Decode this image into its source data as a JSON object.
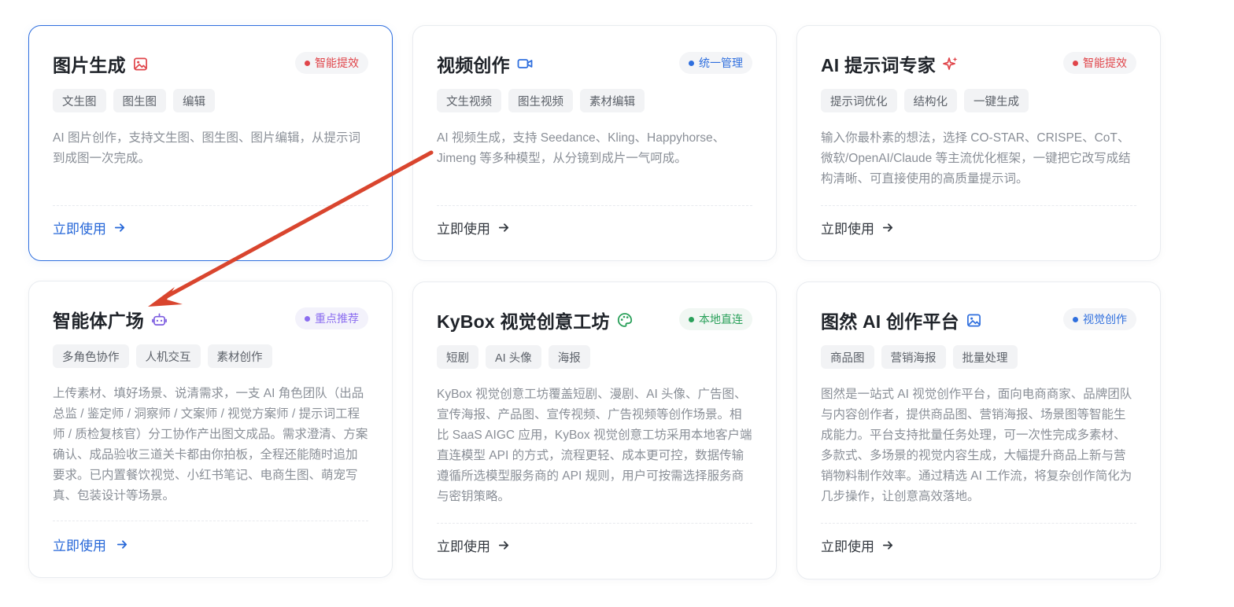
{
  "cards": [
    {
      "title": "图片生成",
      "title_icon": "image-icon",
      "title_icon_color": "#e0454a",
      "badge": {
        "label": "智能提效",
        "dot_color": "#e0454a",
        "text_color": "#e0454a"
      },
      "tags": [
        "文生图",
        "图生图",
        "编辑"
      ],
      "description": "AI 图片创作，支持文生图、图生图、图片编辑，从提示词到成图一次完成。",
      "cta": "立即使用"
    },
    {
      "title": "视频创作",
      "title_icon": "video-camera-icon",
      "title_icon_color": "#2f6fde",
      "badge": {
        "label": "统一管理",
        "dot_color": "#2f6fde",
        "text_color": "#2f6fde"
      },
      "tags": [
        "文生视频",
        "图生视频",
        "素材编辑"
      ],
      "description": "AI 视频生成，支持 Seedance、Kling、Happyhorse、Jimeng 等多种模型，从分镜到成片一气呵成。",
      "cta": "立即使用"
    },
    {
      "title": "AI 提示词专家",
      "title_icon": "sparkles-icon",
      "title_icon_color": "#e0454a",
      "badge": {
        "label": "智能提效",
        "dot_color": "#e0454a",
        "text_color": "#e0454a"
      },
      "tags": [
        "提示词优化",
        "结构化",
        "一键生成"
      ],
      "description": "输入你最朴素的想法，选择 CO-STAR、CRISPE、CoT、微软/OpenAI/Claude 等主流优化框架，一键把它改写成结构清晰、可直接使用的高质量提示词。",
      "cta": "立即使用"
    },
    {
      "title": "智能体广场",
      "title_icon": "robot-icon",
      "title_icon_color": "#7c5ce0",
      "badge": {
        "label": "重点推荐",
        "dot_color": "#8b6df0",
        "text_color": "#8b6df0"
      },
      "tags": [
        "多角色协作",
        "人机交互",
        "素材创作"
      ],
      "description": "上传素材、填好场景、说清需求，一支 AI 角色团队（出品总监 / 鉴定师 / 洞察师 / 文案师 / 视觉方案师 / 提示词工程师 / 质检复核官）分工协作产出图文成品。需求澄清、方案确认、成品验收三道关卡都由你拍板，全程还能随时追加要求。已内置餐饮视觉、小红书笔记、电商生图、萌宠写真、包装设计等场景。",
      "cta": "立即使用"
    },
    {
      "title": "KyBox 视觉创意工坊",
      "title_icon": "palette-icon",
      "title_icon_color": "#2aa05a",
      "badge": {
        "label": "本地直连",
        "dot_color": "#2aa05a",
        "text_color": "#2aa05a"
      },
      "tags": [
        "短剧",
        "AI 头像",
        "海报"
      ],
      "description": "KyBox 视觉创意工坊覆盖短剧、漫剧、AI 头像、广告图、宣传海报、产品图、宣传视频、广告视频等创作场景。相比 SaaS AIGC 应用，KyBox 视觉创意工坊采用本地客户端直连模型 API 的方式，流程更轻、成本更可控，数据传输遵循所选模型服务商的 API 规则，用户可按需选择服务商与密钥策略。",
      "cta": "立即使用"
    },
    {
      "title": "图然 AI 创作平台",
      "title_icon": "picture-frame-icon",
      "title_icon_color": "#2f6fde",
      "badge": {
        "label": "视觉创作",
        "dot_color": "#2f6fde",
        "text_color": "#2f6fde"
      },
      "tags": [
        "商品图",
        "营销海报",
        "批量处理"
      ],
      "description": "图然是一站式 AI 视觉创作平台，面向电商商家、品牌团队与内容创作者，提供商品图、营销海报、场景图等智能生成能力。平台支持批量任务处理，可一次性完成多素材、多款式、多场景的视觉内容生成，大幅提升商品上新与营销物料制作效率。通过精选 AI 工作流，将复杂创作简化为几步操作，让创意高效落地。",
      "cta": "立即使用"
    }
  ],
  "annotation": {
    "type": "arrow",
    "color": "#d9452e"
  }
}
